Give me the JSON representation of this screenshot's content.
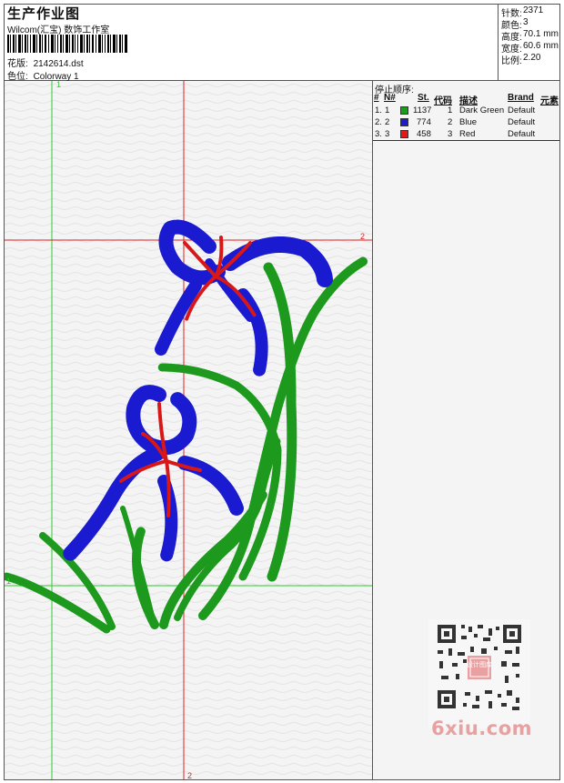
{
  "header": {
    "title": "生产作业图",
    "subtitle": "Wilcom(汇宝) 数饰工作室",
    "file_label": "花版:",
    "file_value": "2142614.dst",
    "colorway_label": "色位:",
    "colorway_value": "Colorway 1"
  },
  "stats": [
    {
      "label": "针数:",
      "value": "2371"
    },
    {
      "label": "颜色:",
      "value": "3"
    },
    {
      "label": "高度:",
      "value": "70.1 mm"
    },
    {
      "label": "宽度:",
      "value": "60.6 mm"
    },
    {
      "label": "比例:",
      "value": "2.20"
    }
  ],
  "stop_sequence": {
    "title": "停止顺序:",
    "headers": {
      "idx": "#",
      "num": "N#",
      "st": "St.",
      "code": "代码",
      "desc": "描述",
      "brand": "Brand",
      "elem": "元素"
    },
    "rows": [
      {
        "idx": "1.",
        "num": "1",
        "st": "1137",
        "code": "1",
        "desc": "Dark Green",
        "brand": "Default",
        "color": "#17a017"
      },
      {
        "idx": "2.",
        "num": "2",
        "st": "774",
        "code": "2",
        "desc": "Blue",
        "brand": "Default",
        "color": "#1b1bd6"
      },
      {
        "idx": "3.",
        "num": "3",
        "st": "458",
        "code": "3",
        "desc": "Red",
        "brand": "Default",
        "color": "#e01818"
      }
    ]
  },
  "guides": {
    "v1": "1",
    "h1": "1",
    "v2": "2",
    "h2": "2"
  },
  "watermark": {
    "text": "6xiu.com",
    "qr_label": "设计图库"
  },
  "colors": {
    "green_guide": "#2ecc2e",
    "red_guide": "#e02020",
    "thread_green": "#1d9a1d",
    "thread_blue": "#1a1ad0",
    "thread_red": "#d81818"
  }
}
